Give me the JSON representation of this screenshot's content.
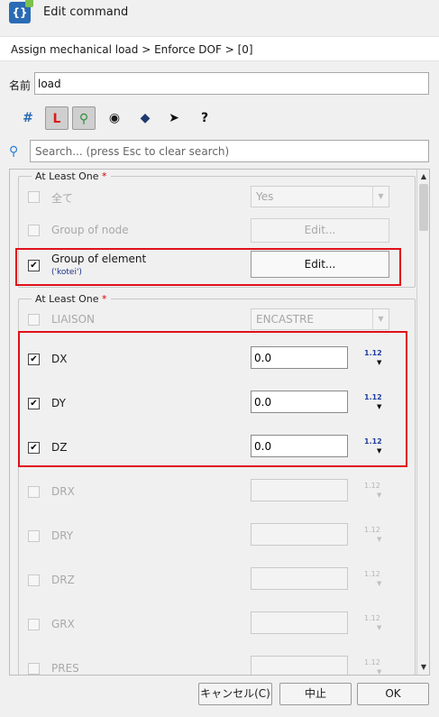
{
  "window": {
    "title": "Edit command"
  },
  "breadcrumb": "Assign mechanical load > Enforce DOF > [0]",
  "name_field": {
    "label": "名前",
    "value": "load"
  },
  "toolbar": {
    "icons": [
      "hash-icon",
      "local-axes-icon",
      "tree-visibility-icon",
      "eye-icon",
      "view-3d-icon",
      "cursor-help-icon",
      "manual-icon"
    ]
  },
  "search": {
    "placeholder": "Search... (press Esc to clear search)"
  },
  "group1": {
    "title": "At Least One",
    "required_mark": "*",
    "rows": [
      {
        "label": "全て",
        "checked": false,
        "enabled": false,
        "control": "combo",
        "value": "Yes"
      },
      {
        "label": "Group of node",
        "checked": false,
        "enabled": false,
        "control": "button",
        "button_label": "Edit..."
      },
      {
        "label": "Group of element",
        "sublabel": "('kotei')",
        "checked": true,
        "enabled": true,
        "control": "button",
        "button_label": "Edit..."
      }
    ]
  },
  "group2": {
    "title": "At Least One",
    "required_mark": "*",
    "liaison": {
      "label": "LIAISON",
      "checked": false,
      "enabled": false,
      "value": "ENCASTRE"
    },
    "dof_rows": [
      {
        "label": "DX",
        "checked": true,
        "value": "0.0",
        "type_icon": "1.12"
      },
      {
        "label": "DY",
        "checked": true,
        "value": "0.0",
        "type_icon": "1.12"
      },
      {
        "label": "DZ",
        "checked": true,
        "value": "0.0",
        "type_icon": "1.12"
      },
      {
        "label": "DRX",
        "checked": false,
        "value": "",
        "type_icon": "1.12"
      },
      {
        "label": "DRY",
        "checked": false,
        "value": "",
        "type_icon": "1.12"
      },
      {
        "label": "DRZ",
        "checked": false,
        "value": "",
        "type_icon": "1.12"
      },
      {
        "label": "GRX",
        "checked": false,
        "value": "",
        "type_icon": "1.12"
      },
      {
        "label": "PRES",
        "checked": false,
        "value": "",
        "type_icon": "1.12"
      }
    ]
  },
  "buttons": {
    "cancel": "キャンセル(C)",
    "abort": "中止",
    "ok": "OK"
  },
  "colors": {
    "highlight": "#e0101a",
    "accent": "#2a6bb5"
  }
}
